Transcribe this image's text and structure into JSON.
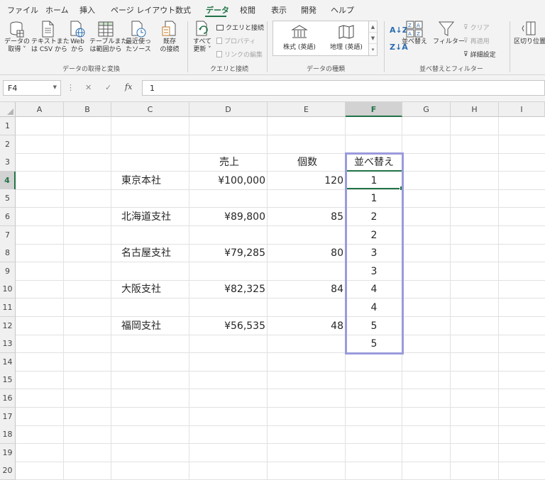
{
  "tabs": [
    {
      "label": "ファイル",
      "active": false
    },
    {
      "label": "ホーム",
      "active": false
    },
    {
      "label": "挿入",
      "active": false
    },
    {
      "label": "ページ レイアウト",
      "active": false
    },
    {
      "label": "数式",
      "active": false
    },
    {
      "label": "データ",
      "active": true
    },
    {
      "label": "校閲",
      "active": false
    },
    {
      "label": "表示",
      "active": false
    },
    {
      "label": "開発",
      "active": false
    },
    {
      "label": "ヘルプ",
      "active": false
    }
  ],
  "ribbon": {
    "get_data": {
      "line1": "データの",
      "line2": "取得 ˅"
    },
    "from_text_csv": {
      "line1": "テキストまた",
      "line2": "は CSV から"
    },
    "from_web": {
      "line1": "Web",
      "line2": "から"
    },
    "from_table": {
      "line1": "テーブルまた",
      "line2": "は範囲から"
    },
    "recent_sources": {
      "line1": "最近使っ",
      "line2": "たソース"
    },
    "existing_connections": {
      "line1": "既存",
      "line2": "の接続"
    },
    "group_get_transform": "データの取得と変換",
    "refresh_all": {
      "line1": "すべて",
      "line2": "更新 ˅"
    },
    "queries_connections": "クエリと接続",
    "properties": "プロパティ",
    "edit_links": "リンクの編集",
    "group_queries": "クエリと接続",
    "data_types": [
      {
        "label": "株式 (英語)"
      },
      {
        "label": "地理 (英語)"
      }
    ],
    "group_data_types": "データの種類",
    "sort_label": "並べ替え",
    "filter_label": "フィルター",
    "clear_label": "クリア",
    "reapply_label": "再適用",
    "advanced_label": "詳細設定",
    "group_sort_filter": "並べ替えとフィルター",
    "text_to_columns": "区切り位置"
  },
  "formula_bar": {
    "name_box": "F4",
    "cancel_icon": "✕",
    "enter_icon": "✓",
    "fx_label": "fx",
    "formula": "1"
  },
  "columns": [
    "A",
    "B",
    "C",
    "D",
    "E",
    "F",
    "G",
    "H",
    "I"
  ],
  "rows": [
    "1",
    "2",
    "3",
    "4",
    "5",
    "6",
    "7",
    "8",
    "9",
    "10",
    "11",
    "12",
    "13",
    "14",
    "15",
    "16",
    "17",
    "18",
    "19",
    "20"
  ],
  "headers": {
    "sales": "売上",
    "count": "個数",
    "sort": "並べ替え"
  },
  "table": [
    {
      "branch": "東京本社",
      "sales": "¥100,000",
      "count": "120",
      "sort": "1"
    },
    {
      "branch": "",
      "sales": "",
      "count": "",
      "sort": "1"
    },
    {
      "branch": "北海道支社",
      "sales": "¥89,800",
      "count": "85",
      "sort": "2"
    },
    {
      "branch": "",
      "sales": "",
      "count": "",
      "sort": "2"
    },
    {
      "branch": "名古屋支社",
      "sales": "¥79,285",
      "count": "80",
      "sort": "3"
    },
    {
      "branch": "",
      "sales": "",
      "count": "",
      "sort": "3"
    },
    {
      "branch": "大阪支社",
      "sales": "¥82,325",
      "count": "84",
      "sort": "4"
    },
    {
      "branch": "",
      "sales": "",
      "count": "",
      "sort": "4"
    },
    {
      "branch": "福岡支社",
      "sales": "¥56,535",
      "count": "48",
      "sort": "5"
    },
    {
      "branch": "",
      "sales": "",
      "count": "",
      "sort": "5"
    }
  ],
  "colors": {
    "accent": "#217346",
    "highlight": "#9a9bdc"
  }
}
